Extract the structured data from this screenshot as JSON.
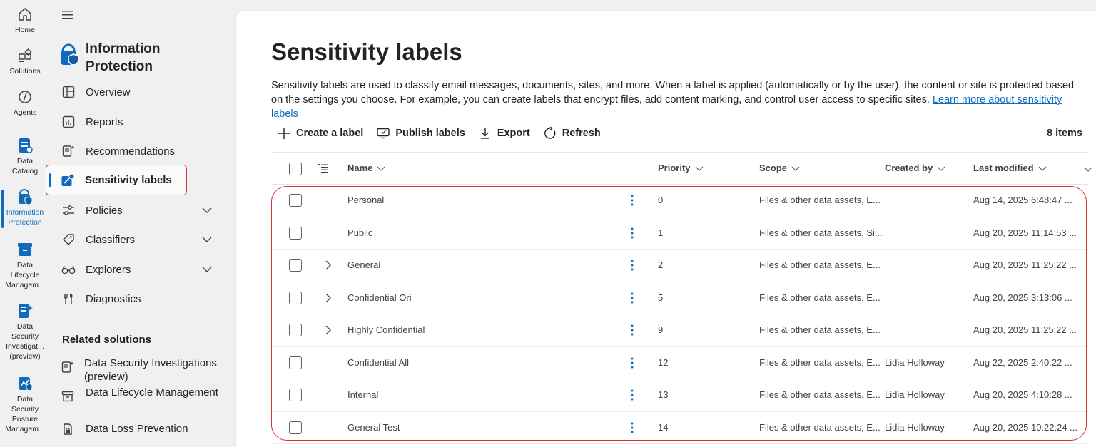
{
  "rail": {
    "items": [
      {
        "label": "Home",
        "icon": "home-icon"
      },
      {
        "label": "Solutions",
        "icon": "solutions-icon"
      },
      {
        "label": "Agents",
        "icon": "agents-icon"
      },
      {
        "label": "Data\nCatalog",
        "icon": "data-catalog-icon"
      },
      {
        "label": "Information\nProtection",
        "icon": "information-protection-icon"
      },
      {
        "label": "Data\nLifecycle\nManagem...",
        "icon": "data-lifecycle-icon"
      },
      {
        "label": "Data\nSecurity\nInvestigat...\n(preview)",
        "icon": "data-security-investigations-icon"
      },
      {
        "label": "Data\nSecurity\nPosture\nManagem...",
        "icon": "data-security-posture-icon"
      }
    ]
  },
  "nav": {
    "title": "Information Protection",
    "items": [
      {
        "label": "Overview",
        "icon": "overview-icon"
      },
      {
        "label": "Reports",
        "icon": "reports-icon"
      },
      {
        "label": "Recommendations",
        "icon": "recommendations-icon"
      },
      {
        "label": "Sensitivity labels",
        "icon": "sensitivity-labels-icon"
      },
      {
        "label": "Policies",
        "icon": "policies-icon"
      },
      {
        "label": "Classifiers",
        "icon": "classifiers-icon"
      },
      {
        "label": "Explorers",
        "icon": "explorers-icon"
      },
      {
        "label": "Diagnostics",
        "icon": "diagnostics-icon"
      }
    ],
    "related_title": "Related solutions",
    "related": [
      {
        "label": "Data Security Investigations (preview)",
        "icon": "data-security-investigations-icon"
      },
      {
        "label": "Data Lifecycle Management",
        "icon": "data-lifecycle-icon"
      },
      {
        "label": "Data Loss Prevention",
        "icon": "data-loss-prevention-icon"
      }
    ]
  },
  "main": {
    "title": "Sensitivity labels",
    "description": "Sensitivity labels are used to classify email messages, documents, sites, and more. When a label is applied (automatically or by the user), the content or site is protected based on the settings you choose. For example, you can create labels that encrypt files, add content marking, and control user access to specific sites.",
    "learn_more": "Learn more about sensitivity labels",
    "toolbar": {
      "create": "Create a label",
      "publish": "Publish labels",
      "export": "Export",
      "refresh": "Refresh"
    },
    "item_count": "8 items"
  },
  "table": {
    "columns": {
      "name": "Name",
      "priority": "Priority",
      "scope": "Scope",
      "created_by": "Created by",
      "last_modified": "Last modified"
    },
    "rows": [
      {
        "name": "Personal",
        "priority": "0",
        "scope": "Files & other data assets, E...",
        "created_by": "",
        "last_modified": "Aug 14, 2025 6:48:47 ...",
        "expandable": false
      },
      {
        "name": "Public",
        "priority": "1",
        "scope": "Files & other data assets, Si...",
        "created_by": "",
        "last_modified": "Aug 20, 2025 11:14:53 ...",
        "expandable": false
      },
      {
        "name": "General",
        "priority": "2",
        "scope": "Files & other data assets, E...",
        "created_by": "",
        "last_modified": "Aug 20, 2025 11:25:22 ...",
        "expandable": true
      },
      {
        "name": "Confidential Ori",
        "priority": "5",
        "scope": "Files & other data assets, E...",
        "created_by": "",
        "last_modified": "Aug 20, 2025 3:13:06 ...",
        "expandable": true
      },
      {
        "name": "Highly Confidential",
        "priority": "9",
        "scope": "Files & other data assets, E...",
        "created_by": "",
        "last_modified": "Aug 20, 2025 11:25:22 ...",
        "expandable": true
      },
      {
        "name": "Confidential All",
        "priority": "12",
        "scope": "Files & other data assets, E...",
        "created_by": "Lidia Holloway",
        "last_modified": "Aug 22, 2025 2:40:22 ...",
        "expandable": false
      },
      {
        "name": "Internal",
        "priority": "13",
        "scope": "Files & other data assets, E...",
        "created_by": "Lidia Holloway",
        "last_modified": "Aug 20, 2025 4:10:28 ...",
        "expandable": false
      },
      {
        "name": "General Test",
        "priority": "14",
        "scope": "Files & other data assets, E...",
        "created_by": "Lidia Holloway",
        "last_modified": "Aug 20, 2025 10:22:24 ...",
        "expandable": false
      }
    ]
  },
  "colors": {
    "accent": "#0f6cbd",
    "highlight": "#d13438",
    "text": "#242424",
    "background": "#f0f0f0"
  }
}
